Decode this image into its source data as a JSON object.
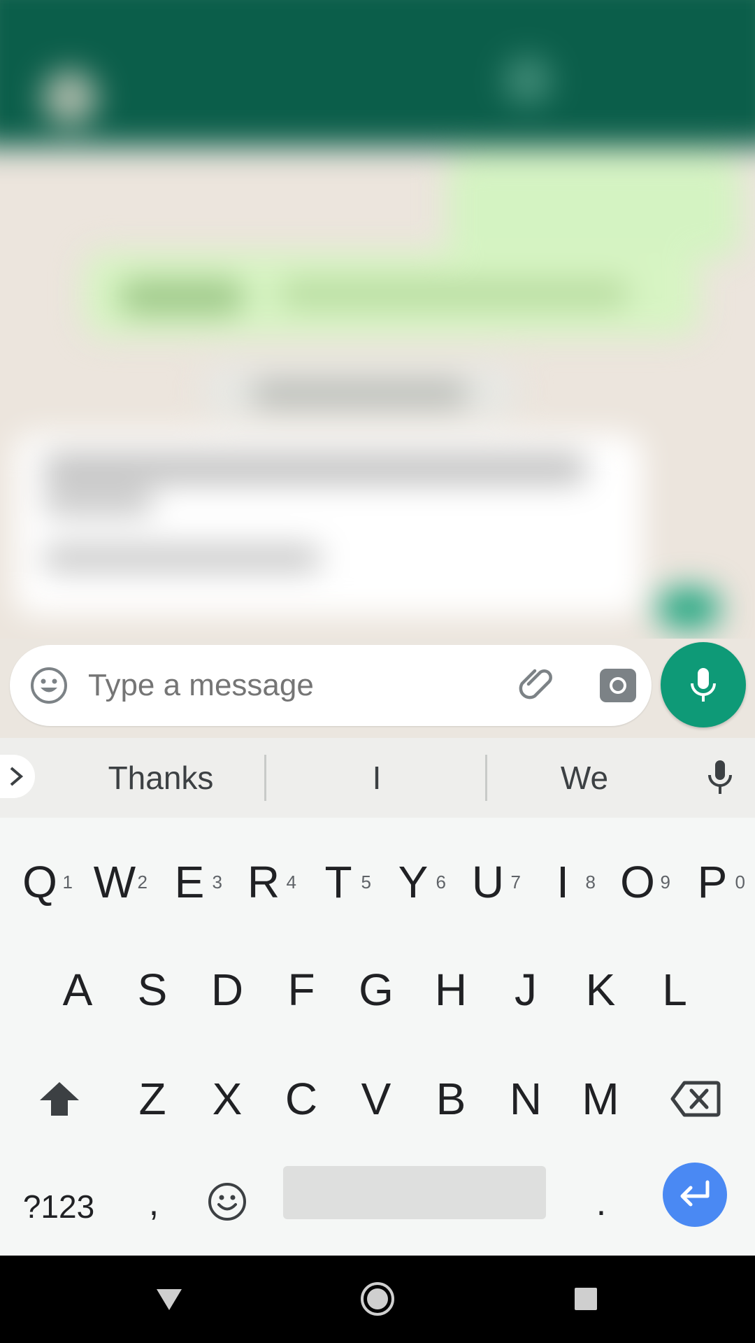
{
  "composer": {
    "placeholder": "Type a message",
    "accent_color": "#0e9a77"
  },
  "suggestions": {
    "items": [
      "Thanks",
      "I",
      "We"
    ]
  },
  "keyboard": {
    "row1": [
      {
        "label": "Q",
        "hint": "1"
      },
      {
        "label": "W",
        "hint": "2"
      },
      {
        "label": "E",
        "hint": "3"
      },
      {
        "label": "R",
        "hint": "4"
      },
      {
        "label": "T",
        "hint": "5"
      },
      {
        "label": "Y",
        "hint": "6"
      },
      {
        "label": "U",
        "hint": "7"
      },
      {
        "label": "I",
        "hint": "8"
      },
      {
        "label": "O",
        "hint": "9"
      },
      {
        "label": "P",
        "hint": "0"
      }
    ],
    "row2": [
      "A",
      "S",
      "D",
      "F",
      "G",
      "H",
      "J",
      "K",
      "L"
    ],
    "row3": [
      "Z",
      "X",
      "C",
      "V",
      "B",
      "N",
      "M"
    ],
    "symbols_label": "?123",
    "comma_label": ",",
    "period_label": ".",
    "enter_color": "#4a89f3"
  }
}
